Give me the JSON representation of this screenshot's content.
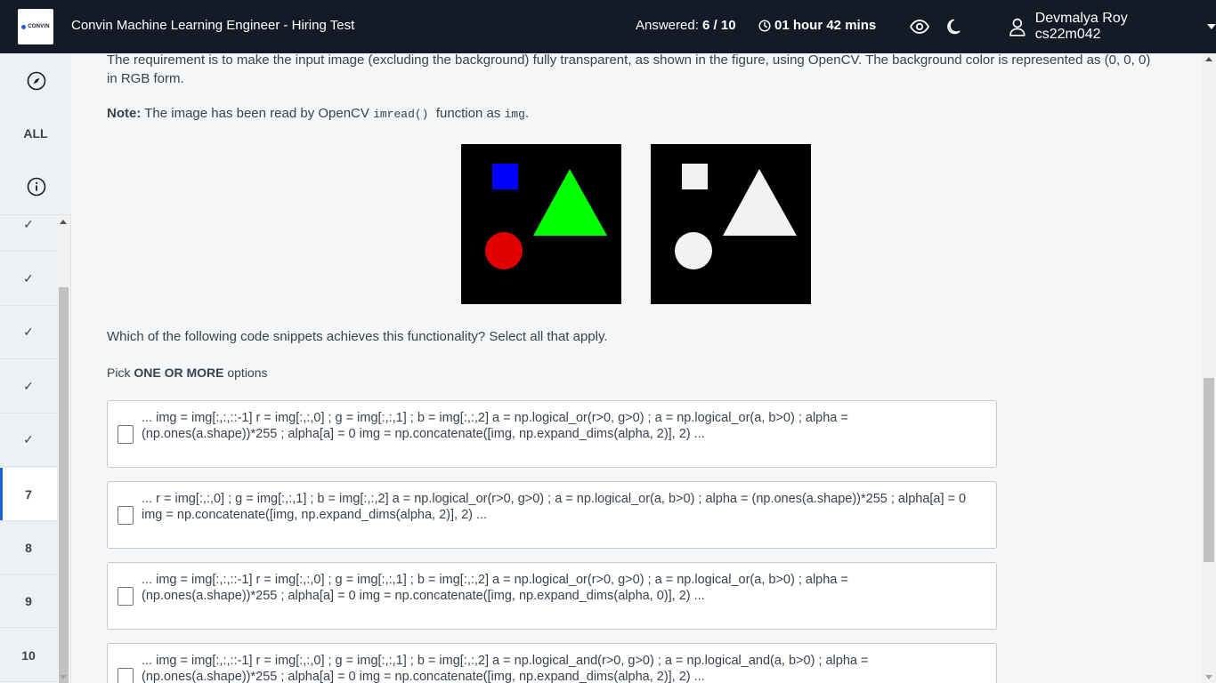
{
  "header": {
    "logo_text": "CONVIN",
    "title": "Convin Machine Learning Engineer - Hiring Test",
    "answered_label": "Answered:",
    "answered_value": "6 / 10",
    "timer": "01 hour 42 mins",
    "user_name": "Devmalya Roy cs22m042"
  },
  "sidebar": {
    "all_label": "ALL",
    "questions": [
      {
        "label": "✓",
        "state": "answered"
      },
      {
        "label": "✓",
        "state": "answered"
      },
      {
        "label": "✓",
        "state": "answered"
      },
      {
        "label": "✓",
        "state": "answered"
      },
      {
        "label": "✓",
        "state": "answered"
      },
      {
        "label": "7",
        "state": "current"
      },
      {
        "label": "8",
        "state": "unanswered"
      },
      {
        "label": "9",
        "state": "unanswered"
      },
      {
        "label": "10",
        "state": "unanswered"
      }
    ]
  },
  "question": {
    "requirement": "The requirement is to make the input image (excluding the background) fully transparent, as shown in the figure, using OpenCV. The background color is represented as (0, 0, 0) in RGB form.",
    "note_label": "Note:",
    "note_text_1": "The image has been read by OpenCV",
    "note_code_1": "imread()",
    "note_text_2": "function as",
    "note_code_2": "img",
    "note_text_3": ".",
    "prompt": "Which of the following code snippets achieves this functionality? Select all that apply.",
    "pick_prefix": "Pick",
    "pick_bold": "ONE OR MORE",
    "pick_suffix": "options",
    "figure_colors": {
      "background": "#000000",
      "square": "#0000ff",
      "triangle": "#00ff00",
      "circle": "#e00000",
      "mask": "#ffffff"
    }
  },
  "options": [
    {
      "text": "... img = img[:,:,::-1] r = img[:,:,0] ; g = img[:,:,1] ; b = img[:,:,2] a = np.logical_or(r>0, g>0) ; a = np.logical_or(a, b>0) ; alpha = (np.ones(a.shape))*255 ; alpha[a] = 0 img = np.concatenate([img, np.expand_dims(alpha, 2)], 2) ..."
    },
    {
      "text": "... r = img[:,:,0] ; g = img[:,:,1] ; b = img[:,:,2] a = np.logical_or(r>0, g>0) ; a = np.logical_or(a, b>0) ; alpha = (np.ones(a.shape))*255 ; alpha[a] = 0 img = np.concatenate([img, np.expand_dims(alpha, 2)], 2) ..."
    },
    {
      "text": "... img = img[:,:,::-1] r = img[:,:,0] ; g = img[:,:,1] ; b = img[:,:,2] a = np.logical_or(r>0, g>0) ; a = np.logical_or(a, b>0) ; alpha = (np.ones(a.shape))*255 ; alpha[a] = 0 img = np.concatenate([img, np.expand_dims(alpha, 0)], 2) ..."
    },
    {
      "text": "... img = img[:,:,::-1] r = img[:,:,0] ; g = img[:,:,1] ; b = img[:,:,2] a = np.logical_and(r>0, g>0) ; a = np.logical_and(a, b>0) ; alpha = (np.ones(a.shape))*255 ; alpha[a] = 0 img = np.concatenate([img, np.expand_dims(alpha, 2)], 2) ..."
    }
  ],
  "colors": {
    "topbar": "#151b26",
    "accent": "#1b62d6",
    "sidebar_bg": "#eef1f4",
    "content_bg": "#f4f6f7"
  }
}
